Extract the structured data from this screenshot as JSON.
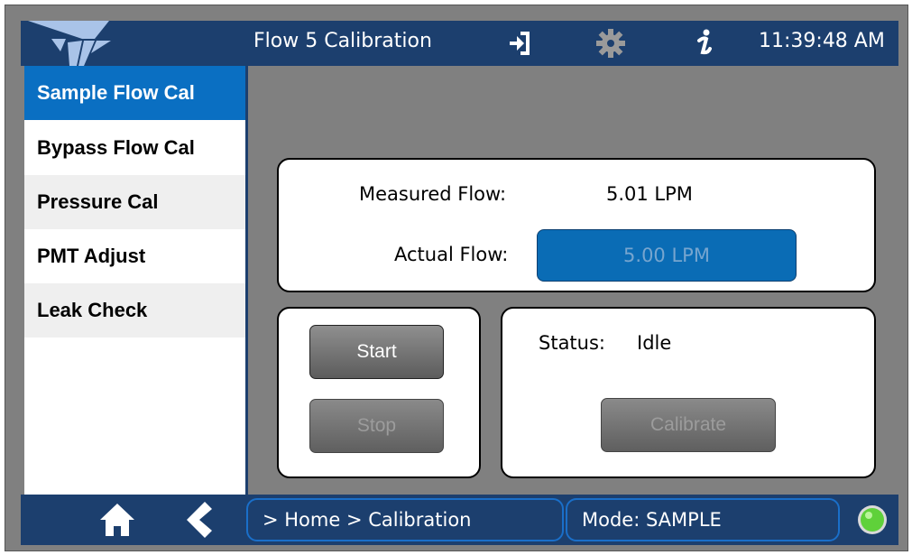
{
  "header": {
    "title": "Flow 5 Calibration",
    "time": "11:39:48 AM",
    "icons": [
      "teledyne-logo",
      "exit-icon",
      "gear-icon",
      "info-icon"
    ]
  },
  "sidebar": {
    "items": [
      {
        "label": "Sample Flow Cal",
        "active": true
      },
      {
        "label": "Bypass Flow Cal",
        "active": false
      },
      {
        "label": "Pressure Cal",
        "active": false
      },
      {
        "label": "PMT Adjust",
        "active": false
      },
      {
        "label": "Leak Check",
        "active": false
      }
    ]
  },
  "flow": {
    "measured_label": "Measured Flow:",
    "measured_value": "5.01 LPM",
    "actual_label": "Actual Flow:",
    "actual_value": "5.00 LPM"
  },
  "controls": {
    "start_label": "Start",
    "stop_label": "Stop"
  },
  "status": {
    "label": "Status:",
    "value": "Idle",
    "calibrate_label": "Calibrate"
  },
  "footer": {
    "breadcrumb": "> Home > Calibration",
    "mode": "Mode: SAMPLE",
    "icons": [
      "home-icon",
      "back-icon",
      "status-led-icon"
    ]
  },
  "colors": {
    "bar": "#1c3f6e",
    "accent": "#0a6fc2",
    "content_bg": "#808080",
    "led": "#5fd13a"
  }
}
